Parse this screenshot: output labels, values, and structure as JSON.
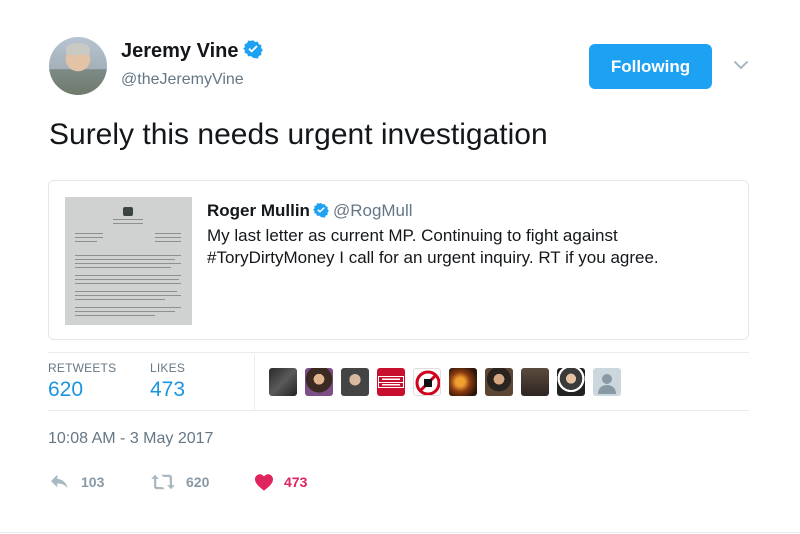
{
  "author": {
    "name": "Jeremy Vine",
    "handle": "@theJeremyVine",
    "verified_icon": "verified-badge-icon"
  },
  "follow_button": {
    "label": "Following"
  },
  "tweet": {
    "text": "Surely this needs urgent investigation"
  },
  "quoted_tweet": {
    "name": "Roger Mullin",
    "handle": "@RogMull",
    "text": "My last letter as current MP. Continuing to fight against #ToryDirtyMoney I call for an urgent inquiry. RT if you agree."
  },
  "stats": {
    "retweets_label": "RETWEETS",
    "retweets_value": "620",
    "likes_label": "LIKES",
    "likes_value": "473"
  },
  "likers": [
    {
      "name": "liker-1"
    },
    {
      "name": "liker-2"
    },
    {
      "name": "liker-3"
    },
    {
      "name": "liker-4",
      "text": "SIGN PAYNE"
    },
    {
      "name": "liker-5",
      "text": "BLOCK KILL REPEAT"
    },
    {
      "name": "liker-6"
    },
    {
      "name": "liker-7"
    },
    {
      "name": "liker-8"
    },
    {
      "name": "liker-9"
    },
    {
      "name": "liker-10"
    }
  ],
  "timestamp": "10:08 AM - 3 May 2017",
  "actions": {
    "reply_count": "103",
    "retweet_count": "620",
    "like_count": "473"
  },
  "colors": {
    "brand_blue": "#1da1f2",
    "link_blue": "#1b95e0",
    "muted": "#657786",
    "like_red": "#e0245e"
  }
}
